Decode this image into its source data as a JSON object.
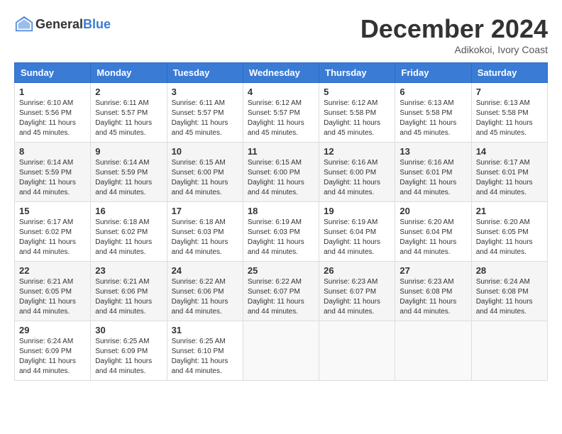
{
  "header": {
    "logo_general": "General",
    "logo_blue": "Blue",
    "month_title": "December 2024",
    "location": "Adikokoi, Ivory Coast"
  },
  "days_of_week": [
    "Sunday",
    "Monday",
    "Tuesday",
    "Wednesday",
    "Thursday",
    "Friday",
    "Saturday"
  ],
  "weeks": [
    [
      {
        "day": "1",
        "sunrise": "6:10 AM",
        "sunset": "5:56 PM",
        "daylight": "11 hours and 45 minutes."
      },
      {
        "day": "2",
        "sunrise": "6:11 AM",
        "sunset": "5:57 PM",
        "daylight": "11 hours and 45 minutes."
      },
      {
        "day": "3",
        "sunrise": "6:11 AM",
        "sunset": "5:57 PM",
        "daylight": "11 hours and 45 minutes."
      },
      {
        "day": "4",
        "sunrise": "6:12 AM",
        "sunset": "5:57 PM",
        "daylight": "11 hours and 45 minutes."
      },
      {
        "day": "5",
        "sunrise": "6:12 AM",
        "sunset": "5:58 PM",
        "daylight": "11 hours and 45 minutes."
      },
      {
        "day": "6",
        "sunrise": "6:13 AM",
        "sunset": "5:58 PM",
        "daylight": "11 hours and 45 minutes."
      },
      {
        "day": "7",
        "sunrise": "6:13 AM",
        "sunset": "5:58 PM",
        "daylight": "11 hours and 45 minutes."
      }
    ],
    [
      {
        "day": "8",
        "sunrise": "6:14 AM",
        "sunset": "5:59 PM",
        "daylight": "11 hours and 44 minutes."
      },
      {
        "day": "9",
        "sunrise": "6:14 AM",
        "sunset": "5:59 PM",
        "daylight": "11 hours and 44 minutes."
      },
      {
        "day": "10",
        "sunrise": "6:15 AM",
        "sunset": "6:00 PM",
        "daylight": "11 hours and 44 minutes."
      },
      {
        "day": "11",
        "sunrise": "6:15 AM",
        "sunset": "6:00 PM",
        "daylight": "11 hours and 44 minutes."
      },
      {
        "day": "12",
        "sunrise": "6:16 AM",
        "sunset": "6:00 PM",
        "daylight": "11 hours and 44 minutes."
      },
      {
        "day": "13",
        "sunrise": "6:16 AM",
        "sunset": "6:01 PM",
        "daylight": "11 hours and 44 minutes."
      },
      {
        "day": "14",
        "sunrise": "6:17 AM",
        "sunset": "6:01 PM",
        "daylight": "11 hours and 44 minutes."
      }
    ],
    [
      {
        "day": "15",
        "sunrise": "6:17 AM",
        "sunset": "6:02 PM",
        "daylight": "11 hours and 44 minutes."
      },
      {
        "day": "16",
        "sunrise": "6:18 AM",
        "sunset": "6:02 PM",
        "daylight": "11 hours and 44 minutes."
      },
      {
        "day": "17",
        "sunrise": "6:18 AM",
        "sunset": "6:03 PM",
        "daylight": "11 hours and 44 minutes."
      },
      {
        "day": "18",
        "sunrise": "6:19 AM",
        "sunset": "6:03 PM",
        "daylight": "11 hours and 44 minutes."
      },
      {
        "day": "19",
        "sunrise": "6:19 AM",
        "sunset": "6:04 PM",
        "daylight": "11 hours and 44 minutes."
      },
      {
        "day": "20",
        "sunrise": "6:20 AM",
        "sunset": "6:04 PM",
        "daylight": "11 hours and 44 minutes."
      },
      {
        "day": "21",
        "sunrise": "6:20 AM",
        "sunset": "6:05 PM",
        "daylight": "11 hours and 44 minutes."
      }
    ],
    [
      {
        "day": "22",
        "sunrise": "6:21 AM",
        "sunset": "6:05 PM",
        "daylight": "11 hours and 44 minutes."
      },
      {
        "day": "23",
        "sunrise": "6:21 AM",
        "sunset": "6:06 PM",
        "daylight": "11 hours and 44 minutes."
      },
      {
        "day": "24",
        "sunrise": "6:22 AM",
        "sunset": "6:06 PM",
        "daylight": "11 hours and 44 minutes."
      },
      {
        "day": "25",
        "sunrise": "6:22 AM",
        "sunset": "6:07 PM",
        "daylight": "11 hours and 44 minutes."
      },
      {
        "day": "26",
        "sunrise": "6:23 AM",
        "sunset": "6:07 PM",
        "daylight": "11 hours and 44 minutes."
      },
      {
        "day": "27",
        "sunrise": "6:23 AM",
        "sunset": "6:08 PM",
        "daylight": "11 hours and 44 minutes."
      },
      {
        "day": "28",
        "sunrise": "6:24 AM",
        "sunset": "6:08 PM",
        "daylight": "11 hours and 44 minutes."
      }
    ],
    [
      {
        "day": "29",
        "sunrise": "6:24 AM",
        "sunset": "6:09 PM",
        "daylight": "11 hours and 44 minutes."
      },
      {
        "day": "30",
        "sunrise": "6:25 AM",
        "sunset": "6:09 PM",
        "daylight": "11 hours and 44 minutes."
      },
      {
        "day": "31",
        "sunrise": "6:25 AM",
        "sunset": "6:10 PM",
        "daylight": "11 hours and 44 minutes."
      },
      null,
      null,
      null,
      null
    ]
  ]
}
